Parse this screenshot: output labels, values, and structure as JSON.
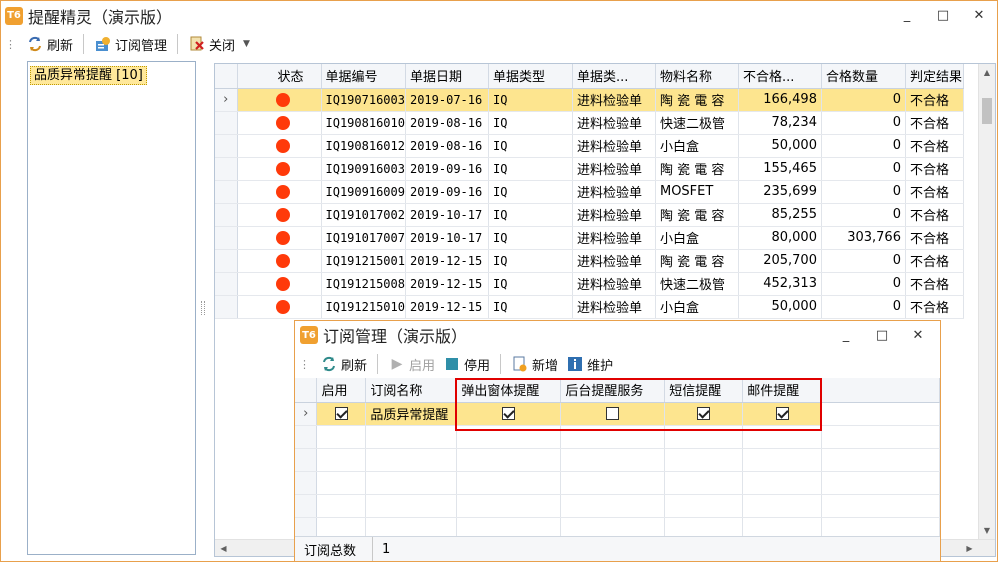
{
  "window": {
    "title": "提醒精灵（演示版）",
    "icon": "T6",
    "controls": [
      "_",
      "□",
      "✕"
    ]
  },
  "toolbar": {
    "grip": "⋮",
    "refresh_label": "刷新",
    "subscribe_label": "订阅管理",
    "close_label": "关闭"
  },
  "tree": {
    "item": "品质异常提醒 [10]"
  },
  "grid": {
    "columns": [
      "状态",
      "单据编号",
      "单据日期",
      "单据类型",
      "单据类...",
      "物料名称",
      "不合格...",
      "合格数量",
      "判定结果"
    ],
    "rows": [
      {
        "no": "IQ190716003",
        "date": "2019-07-16",
        "type": "IQ",
        "typename": "进料检验单",
        "material": "陶 瓷 電 容",
        "bad": "166,498",
        "good": "0",
        "result": "不合格"
      },
      {
        "no": "IQ190816010",
        "date": "2019-08-16",
        "type": "IQ",
        "typename": "进料检验单",
        "material": "快速二极管",
        "bad": "78,234",
        "good": "0",
        "result": "不合格"
      },
      {
        "no": "IQ190816012",
        "date": "2019-08-16",
        "type": "IQ",
        "typename": "进料检验单",
        "material": "小白盒",
        "bad": "50,000",
        "good": "0",
        "result": "不合格"
      },
      {
        "no": "IQ190916003",
        "date": "2019-09-16",
        "type": "IQ",
        "typename": "进料检验单",
        "material": "陶 瓷 電 容",
        "bad": "155,465",
        "good": "0",
        "result": "不合格"
      },
      {
        "no": "IQ190916009",
        "date": "2019-09-16",
        "type": "IQ",
        "typename": "进料检验单",
        "material": "MOSFET",
        "bad": "235,699",
        "good": "0",
        "result": "不合格"
      },
      {
        "no": "IQ191017002",
        "date": "2019-10-17",
        "type": "IQ",
        "typename": "进料检验单",
        "material": "陶 瓷 電 容",
        "bad": "85,255",
        "good": "0",
        "result": "不合格"
      },
      {
        "no": "IQ191017007",
        "date": "2019-10-17",
        "type": "IQ",
        "typename": "进料检验单",
        "material": "小白盒",
        "bad": "80,000",
        "good": "303,766",
        "result": "不合格"
      },
      {
        "no": "IQ191215001",
        "date": "2019-12-15",
        "type": "IQ",
        "typename": "进料检验单",
        "material": "陶 瓷 電 容",
        "bad": "205,700",
        "good": "0",
        "result": "不合格"
      },
      {
        "no": "IQ191215008",
        "date": "2019-12-15",
        "type": "IQ",
        "typename": "进料检验单",
        "material": "快速二极管",
        "bad": "452,313",
        "good": "0",
        "result": "不合格"
      },
      {
        "no": "IQ191215010",
        "date": "2019-12-15",
        "type": "IQ",
        "typename": "进料检验单",
        "material": "小白盒",
        "bad": "50,000",
        "good": "0",
        "result": "不合格"
      }
    ]
  },
  "dialog": {
    "title": "订阅管理（演示版）",
    "icon": "T6",
    "toolbar": {
      "refresh_label": "刷新",
      "enable_label": "启用",
      "disable_label": "停用",
      "add_label": "新增",
      "maintain_label": "维护"
    },
    "columns": [
      "启用",
      "订阅名称",
      "弹出窗体提醒",
      "后台提醒服务",
      "短信提醒",
      "邮件提醒"
    ],
    "row": {
      "enabled": true,
      "name": "品质异常提醒",
      "popup": true,
      "background": false,
      "sms": true,
      "email": true
    },
    "status_label": "订阅总数",
    "status_value": "1"
  },
  "colors": {
    "selected_row": "#fde58f",
    "status_dot": "#ff3a0a",
    "highlight_box": "#e00000",
    "window_border": "#e8a04c"
  }
}
